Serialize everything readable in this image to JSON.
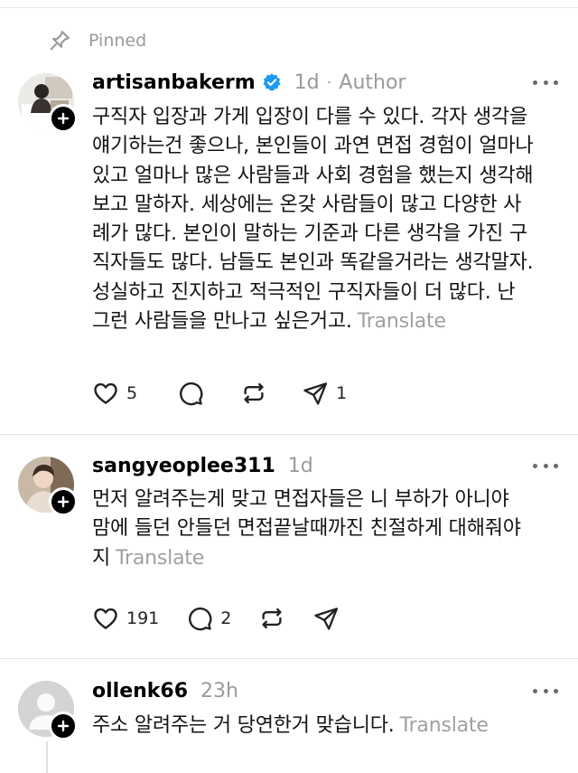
{
  "pinned_label": "Pinned",
  "posts": [
    {
      "username": "artisanbakerm",
      "verified": true,
      "time": "1d",
      "separator": "·",
      "author_tag": "Author",
      "lines": [
        "구직자 입장과 가게 입장이 다를 수 있다. 각자 생각을",
        "얘기하는건 좋으나, 본인들이 과연 면접 경험이 얼마나",
        "있고 얼마나 많은 사람들과 사회 경험을 했는지 생각해",
        "보고 말하자. 세상에는 온갖 사람들이 많고 다양한 사",
        "례가 많다. 본인이 말하는 기준과 다른 생각을 가진 구",
        "직자들도 많다. 남들도 본인과 똑같을거라는 생각말자.",
        "성실하고 진지하고 적극적인 구직자들이 더 많다. 난",
        "그런 사람들을 만나고 싶은거고."
      ],
      "translate": "Translate",
      "likes": "5",
      "replies": "",
      "reposts": "",
      "shares": "1"
    },
    {
      "username": "sangyeoplee311",
      "verified": false,
      "time": "1d",
      "lines": [
        "먼저 알려주는게 맞고 면접자들은 니 부하가 아니야",
        "맘에 들던 안들던 면접끝날때까진 친절하게 대해줘야",
        "지"
      ],
      "translate": "Translate",
      "likes": "191",
      "replies": "2",
      "reposts": "",
      "shares": ""
    },
    {
      "username": "ollenk66",
      "verified": false,
      "time": "23h",
      "lines": [
        "주소 알려주는 거 당연한거 맞습니다."
      ],
      "translate": "Translate"
    }
  ],
  "icons": {
    "pin": "pin-icon",
    "verified": "verified-badge-icon",
    "more": "more-options-icon",
    "like": "heart-icon",
    "reply": "comment-icon",
    "repost": "repost-icon",
    "share": "send-icon",
    "follow": "plus-icon"
  },
  "colors": {
    "verified_blue": "#1d9bf0",
    "muted": "#9a9a9a",
    "text": "#141414"
  }
}
